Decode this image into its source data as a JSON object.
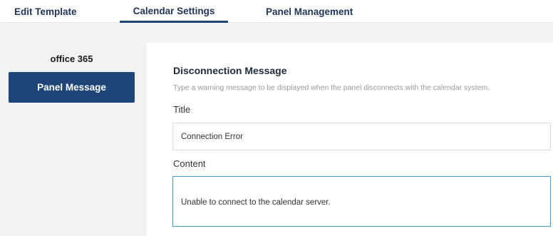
{
  "tabs": [
    {
      "label": "Edit Template",
      "active": false
    },
    {
      "label": "Calendar Settings",
      "active": true
    },
    {
      "label": "Panel Management",
      "active": false
    }
  ],
  "sidebar": {
    "items": [
      {
        "label": "office 365",
        "selected": false
      },
      {
        "label": "Panel Message",
        "selected": true
      }
    ]
  },
  "section": {
    "title": "Disconnection Message",
    "description": "Type a warning message to be displayed when the panel disconnects with the calendar system."
  },
  "form": {
    "title_label": "Title",
    "title_value": "Connection Error",
    "content_label": "Content",
    "content_value": "Unable to connect to the calendar server."
  },
  "colors": {
    "accent": "#1e4478",
    "background": "#f2f2f2",
    "focus_border": "#4a97d6"
  }
}
